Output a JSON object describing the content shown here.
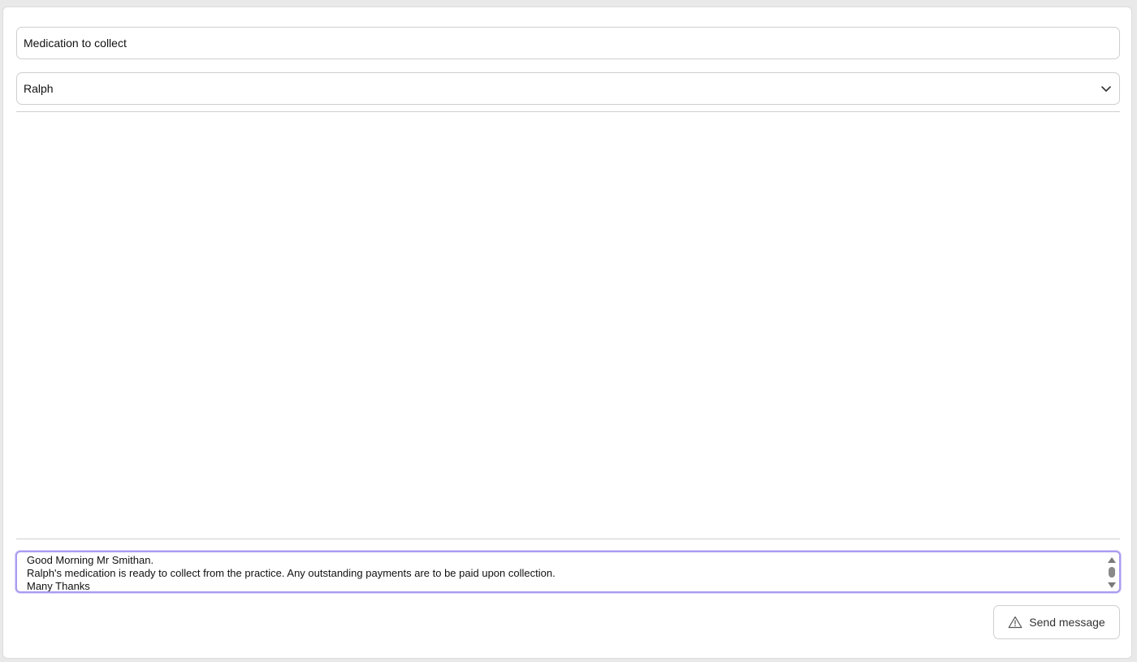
{
  "form": {
    "subject_value": "Medication to collect",
    "pet_select": {
      "selected": "Ralph",
      "icon": "chevron-down-icon"
    }
  },
  "composer": {
    "lines": [
      "Good Morning Mr Smithan.",
      "Ralph's medication is ready to collect from the practice. Any outstanding payments are to be paid upon collection.",
      "Many Thanks"
    ],
    "accent_color": "#a99cf0"
  },
  "actions": {
    "send_label": "Send message",
    "send_icon": "warning-triangle-icon"
  }
}
